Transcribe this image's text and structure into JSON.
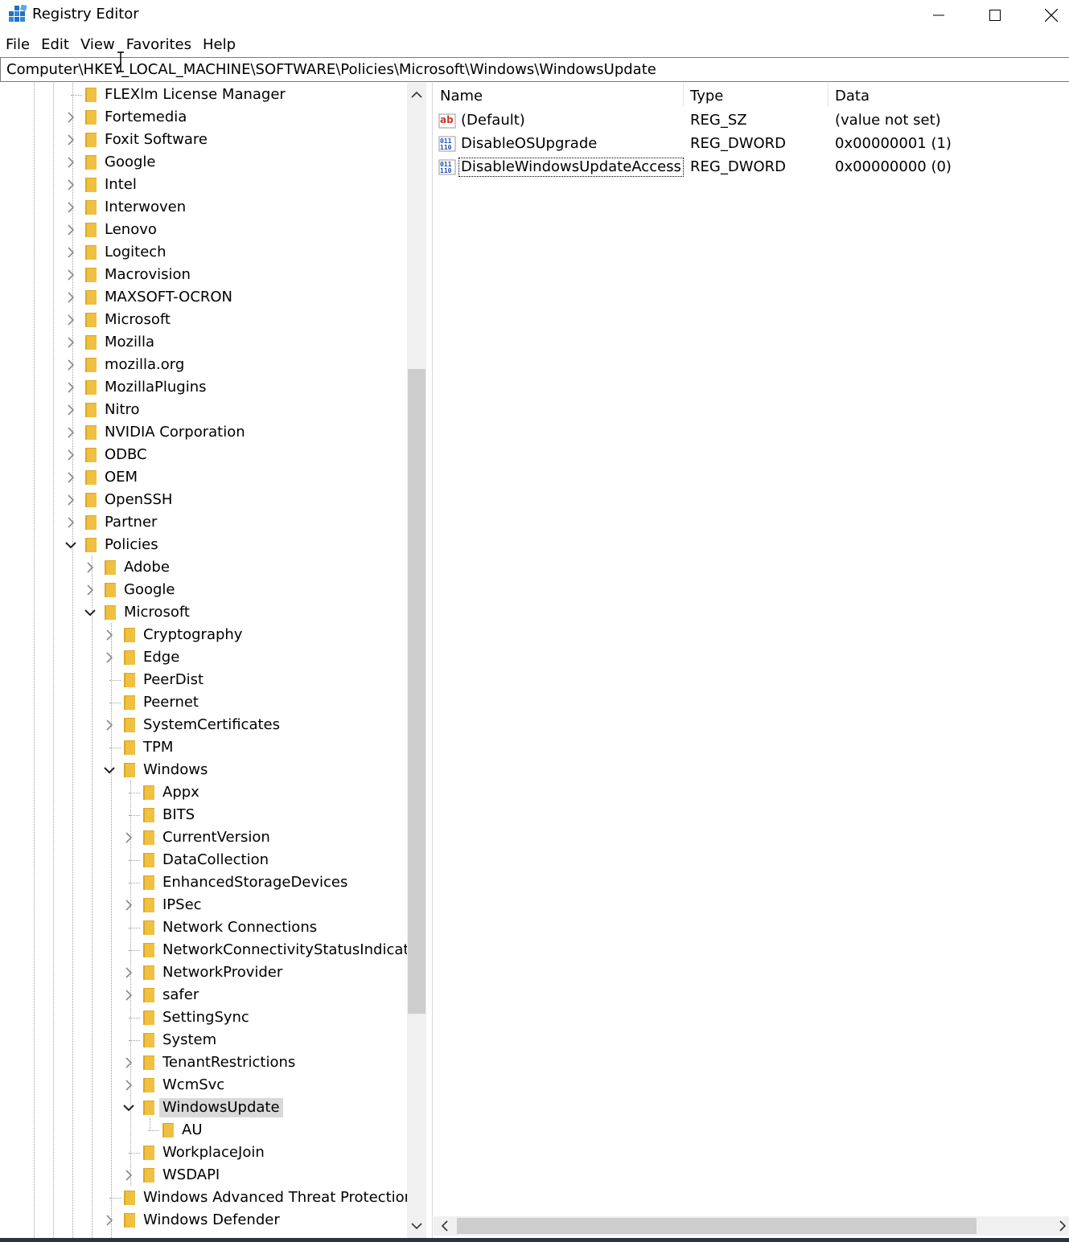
{
  "window": {
    "title": "Registry Editor",
    "controls": [
      "minimize",
      "maximize",
      "close"
    ]
  },
  "menu": [
    "File",
    "Edit",
    "View",
    "Favorites",
    "Help"
  ],
  "address": "Computer\\HKEY_LOCAL_MACHINE\\SOFTWARE\\Policies\\Microsoft\\Windows\\WindowsUpdate",
  "tree": {
    "nodes": [
      {
        "label": "FLEXlm License Manager",
        "depth": 0,
        "expander": "none",
        "name": "tree-node-flexlm"
      },
      {
        "label": "Fortemedia",
        "depth": 0,
        "expander": "collapsed",
        "name": "tree-node-fortemedia"
      },
      {
        "label": "Foxit Software",
        "depth": 0,
        "expander": "collapsed",
        "name": "tree-node-foxit-software"
      },
      {
        "label": "Google",
        "depth": 0,
        "expander": "collapsed",
        "name": "tree-node-google"
      },
      {
        "label": "Intel",
        "depth": 0,
        "expander": "collapsed",
        "name": "tree-node-intel"
      },
      {
        "label": "Interwoven",
        "depth": 0,
        "expander": "collapsed",
        "name": "tree-node-interwoven"
      },
      {
        "label": "Lenovo",
        "depth": 0,
        "expander": "collapsed",
        "name": "tree-node-lenovo"
      },
      {
        "label": "Logitech",
        "depth": 0,
        "expander": "collapsed",
        "name": "tree-node-logitech"
      },
      {
        "label": "Macrovision",
        "depth": 0,
        "expander": "collapsed",
        "name": "tree-node-macrovision"
      },
      {
        "label": "MAXSOFT-OCRON",
        "depth": 0,
        "expander": "collapsed",
        "name": "tree-node-maxsoft-ocron"
      },
      {
        "label": "Microsoft",
        "depth": 0,
        "expander": "collapsed",
        "name": "tree-node-microsoft"
      },
      {
        "label": "Mozilla",
        "depth": 0,
        "expander": "collapsed",
        "name": "tree-node-mozilla"
      },
      {
        "label": "mozilla.org",
        "depth": 0,
        "expander": "collapsed",
        "name": "tree-node-mozilla-org"
      },
      {
        "label": "MozillaPlugins",
        "depth": 0,
        "expander": "collapsed",
        "name": "tree-node-mozillaplugins"
      },
      {
        "label": "Nitro",
        "depth": 0,
        "expander": "collapsed",
        "name": "tree-node-nitro"
      },
      {
        "label": "NVIDIA Corporation",
        "depth": 0,
        "expander": "collapsed",
        "name": "tree-node-nvidia-corporation"
      },
      {
        "label": "ODBC",
        "depth": 0,
        "expander": "collapsed",
        "name": "tree-node-odbc"
      },
      {
        "label": "OEM",
        "depth": 0,
        "expander": "collapsed",
        "name": "tree-node-oem"
      },
      {
        "label": "OpenSSH",
        "depth": 0,
        "expander": "collapsed",
        "name": "tree-node-openssh"
      },
      {
        "label": "Partner",
        "depth": 0,
        "expander": "collapsed",
        "name": "tree-node-partner"
      },
      {
        "label": "Policies",
        "depth": 0,
        "expander": "expanded",
        "name": "tree-node-policies"
      },
      {
        "label": "Adobe",
        "depth": 1,
        "expander": "collapsed",
        "name": "tree-node-policies-adobe"
      },
      {
        "label": "Google",
        "depth": 1,
        "expander": "collapsed",
        "name": "tree-node-policies-google"
      },
      {
        "label": "Microsoft",
        "depth": 1,
        "expander": "expanded",
        "name": "tree-node-policies-microsoft"
      },
      {
        "label": "Cryptography",
        "depth": 2,
        "expander": "collapsed",
        "name": "tree-node-cryptography"
      },
      {
        "label": "Edge",
        "depth": 2,
        "expander": "collapsed",
        "name": "tree-node-edge"
      },
      {
        "label": "PeerDist",
        "depth": 2,
        "expander": "none",
        "name": "tree-node-peerdist"
      },
      {
        "label": "Peernet",
        "depth": 2,
        "expander": "none",
        "name": "tree-node-peernet"
      },
      {
        "label": "SystemCertificates",
        "depth": 2,
        "expander": "collapsed",
        "name": "tree-node-systemcertificates"
      },
      {
        "label": "TPM",
        "depth": 2,
        "expander": "none",
        "name": "tree-node-tpm"
      },
      {
        "label": "Windows",
        "depth": 2,
        "expander": "expanded",
        "name": "tree-node-windows"
      },
      {
        "label": "Appx",
        "depth": 3,
        "expander": "none",
        "name": "tree-node-appx"
      },
      {
        "label": "BITS",
        "depth": 3,
        "expander": "none",
        "name": "tree-node-bits"
      },
      {
        "label": "CurrentVersion",
        "depth": 3,
        "expander": "collapsed",
        "name": "tree-node-currentversion"
      },
      {
        "label": "DataCollection",
        "depth": 3,
        "expander": "none",
        "name": "tree-node-datacollection"
      },
      {
        "label": "EnhancedStorageDevices",
        "depth": 3,
        "expander": "none",
        "name": "tree-node-enhancedstoragedevices"
      },
      {
        "label": "IPSec",
        "depth": 3,
        "expander": "collapsed",
        "name": "tree-node-ipsec"
      },
      {
        "label": "Network Connections",
        "depth": 3,
        "expander": "none",
        "name": "tree-node-network-connections"
      },
      {
        "label": "NetworkConnectivityStatusIndicator",
        "depth": 3,
        "expander": "none",
        "name": "tree-node-ncsi"
      },
      {
        "label": "NetworkProvider",
        "depth": 3,
        "expander": "collapsed",
        "name": "tree-node-networkprovider"
      },
      {
        "label": "safer",
        "depth": 3,
        "expander": "collapsed",
        "name": "tree-node-safer"
      },
      {
        "label": "SettingSync",
        "depth": 3,
        "expander": "none",
        "name": "tree-node-settingsync"
      },
      {
        "label": "System",
        "depth": 3,
        "expander": "none",
        "name": "tree-node-system"
      },
      {
        "label": "TenantRestrictions",
        "depth": 3,
        "expander": "collapsed",
        "name": "tree-node-tenantrestrictions"
      },
      {
        "label": "WcmSvc",
        "depth": 3,
        "expander": "collapsed",
        "name": "tree-node-wcmsvc"
      },
      {
        "label": "WindowsUpdate",
        "depth": 3,
        "expander": "expanded",
        "selected": true,
        "name": "tree-node-windowsupdate"
      },
      {
        "label": "AU",
        "depth": 4,
        "expander": "none",
        "name": "tree-node-au"
      },
      {
        "label": "WorkplaceJoin",
        "depth": 3,
        "expander": "none",
        "name": "tree-node-workplacejoin"
      },
      {
        "label": "WSDAPI",
        "depth": 3,
        "expander": "collapsed",
        "name": "tree-node-wsdapi"
      },
      {
        "label": "Windows Advanced Threat Protection",
        "depth": 2,
        "expander": "none",
        "name": "tree-node-windows-atp"
      },
      {
        "label": "Windows Defender",
        "depth": 2,
        "expander": "collapsed",
        "name": "tree-node-windows-defender"
      }
    ]
  },
  "values": {
    "headers": {
      "name": "Name",
      "type": "Type",
      "data": "Data"
    },
    "rows": [
      {
        "name": "(Default)",
        "type": "REG_SZ",
        "data": "(value not set)",
        "icon": "string-value-icon"
      },
      {
        "name": "DisableOSUpgrade",
        "type": "REG_DWORD",
        "data": "0x00000001 (1)",
        "icon": "binary-value-icon"
      },
      {
        "name": "DisableWindowsUpdateAccess",
        "type": "REG_DWORD",
        "data": "0x00000000 (0)",
        "icon": "binary-value-icon",
        "focused": true
      }
    ]
  },
  "colors": {
    "folder": "#f0c040",
    "folder_dark": "#dca628",
    "selection": "#d9d9d9",
    "scroll_track": "#f0f0f0",
    "scroll_thumb": "#cdcdcd"
  }
}
